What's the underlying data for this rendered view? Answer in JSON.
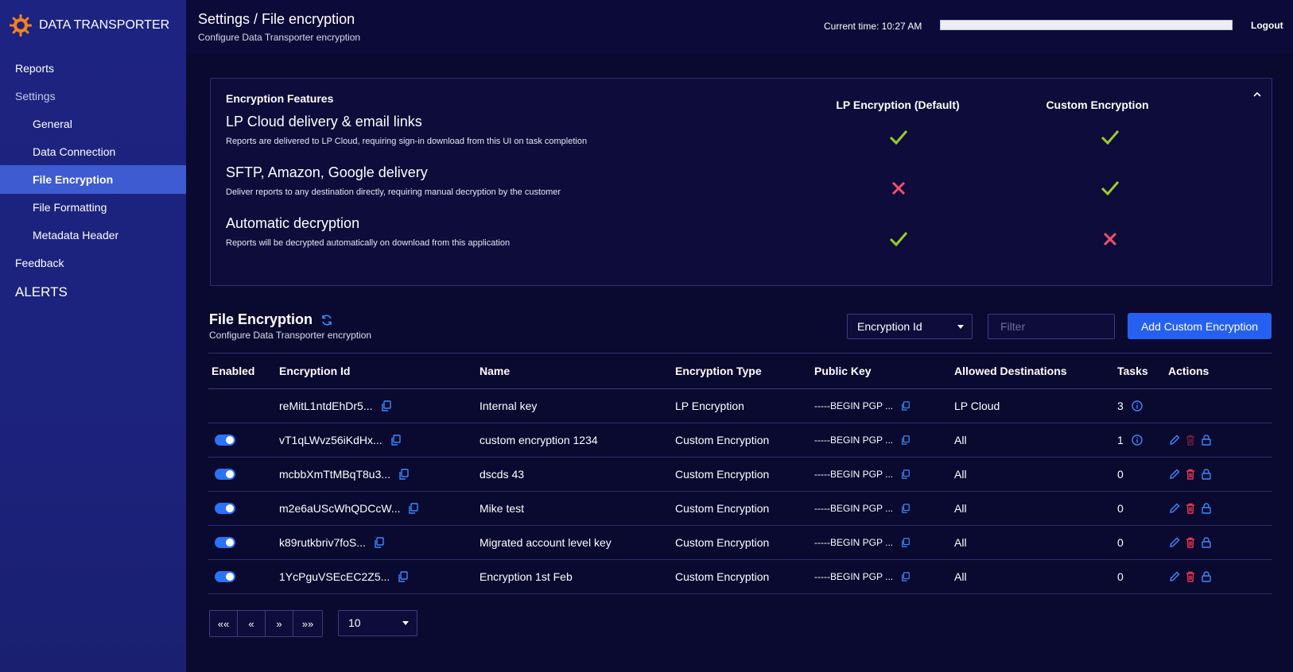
{
  "brand": {
    "name": "DATA TRANSPORTER",
    "logo_icon": "gear-sun-icon",
    "accent": "#f4821f"
  },
  "sidebar": {
    "items": [
      {
        "label": "Reports"
      },
      {
        "label": "Settings"
      },
      {
        "label": "General"
      },
      {
        "label": "Data Connection"
      },
      {
        "label": "File Encryption"
      },
      {
        "label": "File Formatting"
      },
      {
        "label": "Metadata Header"
      },
      {
        "label": "Feedback"
      },
      {
        "label": "ALERTS"
      }
    ],
    "active_color": "#3e5bd1"
  },
  "header": {
    "title": "Settings / File encryption",
    "subtitle": "Configure Data Transporter encryption",
    "current_time": "Current time: 10:27 AM",
    "logout": "Logout"
  },
  "features": {
    "heading": "Encryption Features",
    "col_lp": "LP Encryption (Default)",
    "col_custom": "Custom Encryption",
    "rows": [
      {
        "title": "LP Cloud delivery & email links",
        "desc": "Reports are delivered to LP Cloud, requiring sign-in download from this UI on task completion",
        "lp": true,
        "custom": true
      },
      {
        "title": "SFTP, Amazon, Google delivery",
        "desc": "Deliver reports to any destination directly, requiring manual decryption by the customer",
        "lp": false,
        "custom": true
      },
      {
        "title": "Automatic decryption",
        "desc": "Reports will be decrypted automatically on download from this application",
        "lp": true,
        "custom": false
      }
    ],
    "check_color": "#9ccc2a",
    "cross_color": "#f0506e"
  },
  "encryption": {
    "title": "File Encryption",
    "subtitle": "Configure Data Transporter encryption",
    "select_value": "Encryption Id",
    "filter_placeholder": "Filter",
    "add_button": "Add Custom Encryption",
    "columns": [
      "Enabled",
      "Encryption Id",
      "Name",
      "Encryption Type",
      "Public Key",
      "Allowed Destinations",
      "Tasks",
      "Actions"
    ],
    "rows": [
      {
        "enabled": null,
        "id": "reMitL1ntdEhDr5...",
        "name": "Internal key",
        "type": "LP Encryption",
        "key": "-----BEGIN PGP ...",
        "dest": "LP Cloud",
        "tasks": "3",
        "tasks_info": true,
        "actions": false
      },
      {
        "enabled": true,
        "id": "vT1qLWvz56iKdHx...",
        "name": "custom encryption 1234",
        "type": "Custom Encryption",
        "key": "-----BEGIN PGP ...",
        "dest": "All",
        "tasks": "1",
        "tasks_info": true,
        "actions": true,
        "delete_disabled": true
      },
      {
        "enabled": true,
        "id": "mcbbXmTtMBqT8u3...",
        "name": "dscds 43",
        "type": "Custom Encryption",
        "key": "-----BEGIN PGP ...",
        "dest": "All",
        "tasks": "0",
        "tasks_info": false,
        "actions": true,
        "delete_disabled": false
      },
      {
        "enabled": true,
        "id": "m2e6aUScWhQDCcW...",
        "name": "Mike test",
        "type": "Custom Encryption",
        "key": "-----BEGIN PGP ...",
        "dest": "All",
        "tasks": "0",
        "tasks_info": false,
        "actions": true,
        "delete_disabled": false
      },
      {
        "enabled": true,
        "id": "k89rutkbriv7foS...",
        "name": "Migrated account level key",
        "type": "Custom Encryption",
        "key": "-----BEGIN PGP ...",
        "dest": "All",
        "tasks": "0",
        "tasks_info": false,
        "actions": true,
        "delete_disabled": false
      },
      {
        "enabled": true,
        "id": "1YcPguVSEcEC2Z5...",
        "name": "Encryption 1st Feb",
        "type": "Custom Encryption",
        "key": "-----BEGIN PGP ...",
        "dest": "All",
        "tasks": "0",
        "tasks_info": false,
        "actions": true,
        "delete_disabled": false
      }
    ],
    "pager": [
      "««",
      "«",
      "»",
      "»»"
    ],
    "page_size": "10"
  }
}
